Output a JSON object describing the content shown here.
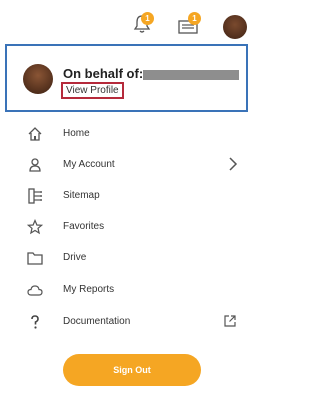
{
  "header": {
    "notifications_count": "1",
    "inbox_count": "1"
  },
  "profile": {
    "behalf_label": "On behalf of:",
    "view_profile_label": "View Profile"
  },
  "menu": {
    "items": [
      {
        "label": "Home",
        "icon": "home-icon"
      },
      {
        "label": "My Account",
        "icon": "person-icon"
      },
      {
        "label": "Sitemap",
        "icon": "sitemap-icon"
      },
      {
        "label": "Favorites",
        "icon": "star-icon"
      },
      {
        "label": "Drive",
        "icon": "folder-icon"
      },
      {
        "label": "My Reports",
        "icon": "cloud-icon"
      },
      {
        "label": "Documentation",
        "icon": "question-icon"
      }
    ]
  },
  "signout_label": "Sign Out",
  "colors": {
    "accent": "#f5a623",
    "profile_border": "#3a73b8",
    "highlight_border": "#b52a3b"
  }
}
